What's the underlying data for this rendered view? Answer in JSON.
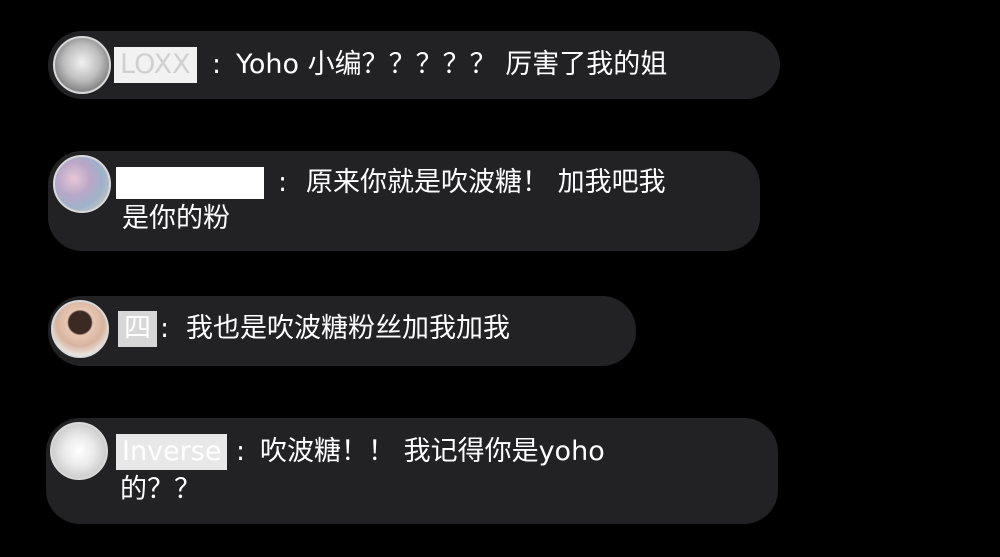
{
  "comments": [
    {
      "username": "LOXX",
      "colon": ":",
      "line1": "Yoho 小编？？？？？ 厉害了我的姐",
      "line2": ""
    },
    {
      "username": "",
      "colon": ":",
      "line1": "原来你就是吹波糖！ 加我吧我",
      "line2": "是你的粉"
    },
    {
      "username": "四",
      "colon": ":",
      "line1": "我也是吹波糖粉丝加我加我",
      "line2": ""
    },
    {
      "username": "Inverse",
      "colon": ":",
      "line1": "吹波糖！！ 我记得你是yoho",
      "line2": "的？？"
    }
  ]
}
